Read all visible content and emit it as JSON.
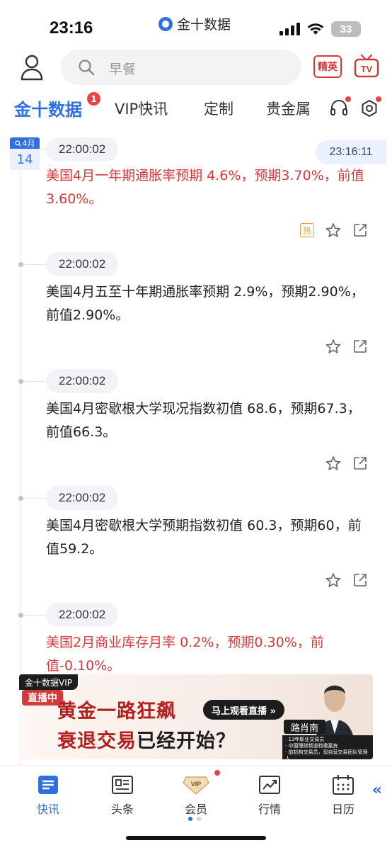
{
  "status_bar": {
    "time": "23:16",
    "app_name": "金十数据",
    "battery": "33"
  },
  "header": {
    "search_placeholder": "早餐",
    "jingying_label": "精英",
    "tv_label": "TV"
  },
  "tabs": [
    {
      "label": "金十数据",
      "badge": "1"
    },
    {
      "label": "VIP快讯"
    },
    {
      "label": "定制"
    },
    {
      "label": "贵金属"
    }
  ],
  "feed": {
    "date_month": "4月",
    "date_day": "14",
    "current_time": "23:16:11",
    "items": [
      {
        "time": "22:00:02",
        "text": "美国4月一年期通胀率预期 4.6%，预期3.70%，前值3.60%。",
        "important": true,
        "hot": "热"
      },
      {
        "time": "22:00:02",
        "text": "美国4月五至十年期通胀率预期 2.9%，预期2.90%，前值2.90%。",
        "important": false
      },
      {
        "time": "22:00:02",
        "text": "美国4月密歇根大学现况指数初值 68.6，预期67.3，前值66.3。",
        "important": false
      },
      {
        "time": "22:00:02",
        "text": "美国4月密歇根大学预期指数初值 60.3，预期60，前值59.2。",
        "important": false
      },
      {
        "time": "22:00:02",
        "text": "美国2月商业库存月率 0.2%，预期0.30%，前值-0.10%。",
        "important": true
      }
    ]
  },
  "ad": {
    "brand": "金十数据VIP",
    "live": "直播中",
    "line1": "黄金一路狂飙",
    "line2_a": "衰退交易",
    "line2_b": "已经开始？",
    "cta": "马上观看直播 »",
    "host_name": "路肖南",
    "host_desc_1": "· 13年职业交易员",
    "host_desc_2": "· 中国理财频道特邀嘉宾",
    "host_desc_3": "· 前机构交易员，现自营交易团队管理人"
  },
  "bottom_nav": [
    {
      "label": "快讯",
      "active": true
    },
    {
      "label": "头条"
    },
    {
      "label": "会员"
    },
    {
      "label": "行情"
    },
    {
      "label": "日历"
    }
  ],
  "colors": {
    "accent": "#2f6fe0",
    "important": "#d43a3a",
    "hot": "#e6a23c"
  }
}
